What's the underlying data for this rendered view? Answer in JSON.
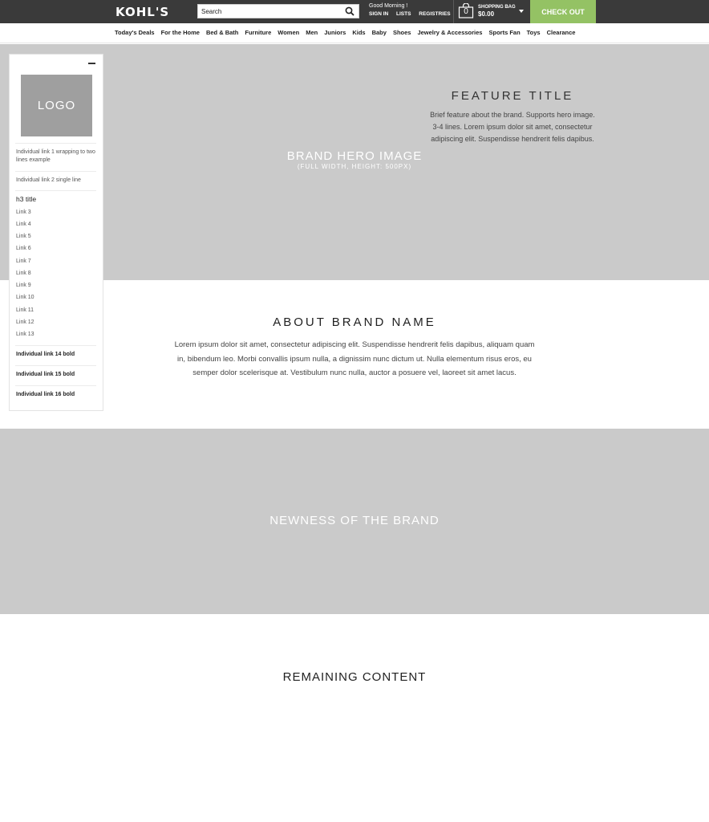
{
  "header": {
    "logo_text": "KOHL'S",
    "search_placeholder": "Search",
    "greeting": "Good Morning !",
    "account_links": [
      "SIGN IN",
      "LISTS",
      "REGISTRIES"
    ],
    "bag_count": "0",
    "bag_label": "SHOPPING BAG",
    "bag_amount": "$0.00",
    "checkout_label": "CHECK OUT",
    "colors": {
      "bar": "#3a3a3a",
      "checkout": "#94c264"
    }
  },
  "nav": {
    "items": [
      "Today's Deals",
      "For the Home",
      "Bed & Bath",
      "Furniture",
      "Women",
      "Men",
      "Juniors",
      "Kids",
      "Baby",
      "Shoes",
      "Jewelry & Accessories",
      "Sports Fan",
      "Toys",
      "Clearance"
    ]
  },
  "hero": {
    "caption": "BRAND HERO IMAGE",
    "subcaption": "(FULL WIDTH, HEIGHT: 500PX)",
    "feature_title": "FEATURE TITLE",
    "feature_text": "Brief feature about the brand. Supports hero image. 3-4 lines. Lorem ipsum dolor sit amet, consectetur adipiscing elit. Suspendisse hendrerit felis dapibus."
  },
  "sidebar": {
    "logo_text": "LOGO",
    "link1": "Individual link 1 wrapping to two lines example",
    "link2": "Individual link 2 single line",
    "h3_title": "h3 title",
    "links": [
      "Link 3",
      "Link 4",
      "Link 5",
      "Link 6",
      "Link 7",
      "Link 8",
      "Link 9",
      "Link 10",
      "Link 11",
      "Link 12",
      "Link 13"
    ],
    "bold_links": [
      "Individual link 14 bold",
      "Individual link 15 bold",
      "Individual link 16 bold"
    ]
  },
  "about": {
    "title": "ABOUT BRAND NAME",
    "text": "Lorem ipsum dolor sit amet, consectetur adipiscing elit. Suspendisse hendrerit felis dapibus, aliquam quam in, bibendum leo. Morbi convallis ipsum nulla, a dignissim nunc dictum ut. Nulla elementum risus eros, eu semper dolor scelerisque at. Vestibulum nunc nulla, auctor a posuere vel, laoreet sit amet lacus."
  },
  "newness": {
    "text": "NEWNESS OF THE BRAND"
  },
  "remaining": {
    "text": "REMAINING CONTENT"
  }
}
